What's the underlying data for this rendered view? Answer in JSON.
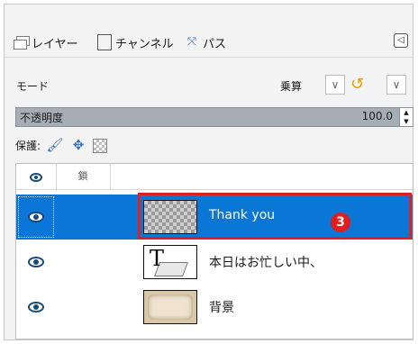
{
  "tabs": [
    {
      "label": "レイヤー",
      "icon": "layers-icon"
    },
    {
      "label": "チャンネル",
      "icon": "channels-icon"
    },
    {
      "label": "パス",
      "icon": "paths-icon"
    }
  ],
  "colors": {
    "selection": "#0a76d6",
    "highlight_border": "#e02020",
    "badge": "#e11d1d",
    "opacity_bar": "#a6adb4"
  },
  "mode": {
    "label": "モード",
    "value": "乗算"
  },
  "opacity": {
    "label": "不透明度",
    "value": "100.0"
  },
  "lock": {
    "label": "保護:"
  },
  "list": {
    "header_chain_label": "鎖"
  },
  "layers": [
    {
      "name": "Thank you",
      "selected": true,
      "visible": true
    },
    {
      "name": "本日はお忙しい中、",
      "selected": false,
      "visible": true
    },
    {
      "name": "背景",
      "selected": false,
      "visible": true
    }
  ],
  "annotation": {
    "badge_number": "3"
  }
}
